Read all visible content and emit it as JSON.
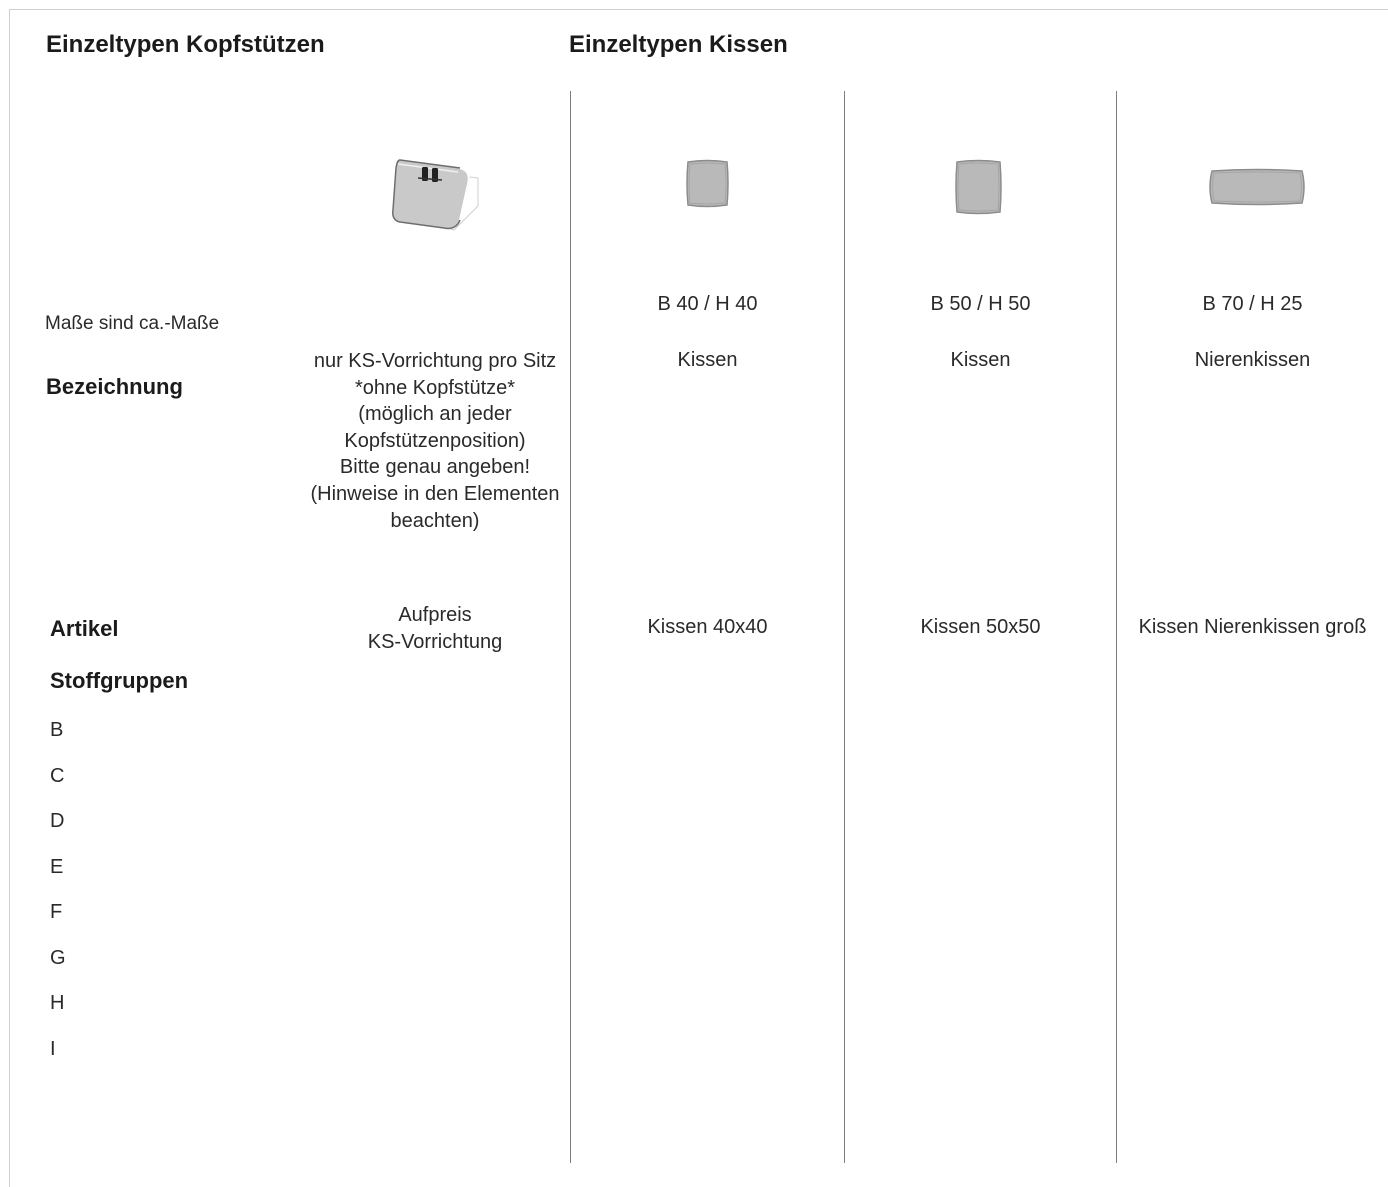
{
  "headrests": {
    "title": "Einzeltypen Kopfstützen",
    "description_lines": [
      "nur KS-Vorrichtung pro Sitz",
      "*ohne Kopfstütze*",
      "(möglich an jeder",
      "Kopfstützenposition)",
      "Bitte genau angeben!",
      "(Hinweise in den Elementen",
      "beachten)"
    ],
    "article_lines": [
      "Aufpreis",
      "KS-Vorrichtung"
    ]
  },
  "cushions": {
    "title": "Einzeltypen Kissen",
    "items": [
      {
        "dims": "B 40 / H 40",
        "name": "Kissen",
        "article": "Kissen 40x40"
      },
      {
        "dims": "B 50 / H 50",
        "name": "Kissen",
        "article": "Kissen 50x50"
      },
      {
        "dims": "B 70 / H 25",
        "name": "Nierenkissen",
        "article": "Kissen Nierenkissen groß"
      }
    ]
  },
  "labels": {
    "dims_note": "Maße sind ca.-Maße",
    "designation": "Bezeichnung",
    "article": "Artikel",
    "fabric_groups": "Stoffgruppen"
  },
  "fabric_groups": [
    "B",
    "C",
    "D",
    "E",
    "F",
    "G",
    "H",
    "I"
  ],
  "colors": {
    "divider": "#7d7d7d",
    "cushion_fill": "#b9b9b9",
    "cushion_edge": "#8c8c8c"
  }
}
